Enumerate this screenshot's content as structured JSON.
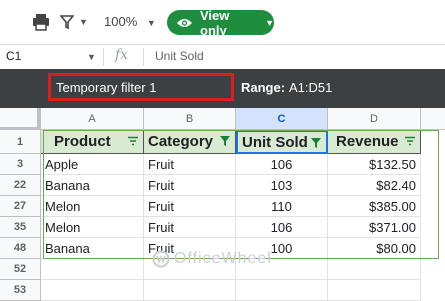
{
  "toolbar": {
    "zoom": "100%",
    "view_button_label": "View only",
    "icons": [
      "print-icon",
      "filter-icon",
      "eye-icon"
    ]
  },
  "formula_bar": {
    "name_box": "C1",
    "fx": "fx",
    "content": "Unit Sold"
  },
  "filter_bar": {
    "filter_name": "Temporary filter 1",
    "range_label": "Range:",
    "range_value": "A1:D51"
  },
  "columns": [
    "A",
    "B",
    "C",
    "D"
  ],
  "headers": [
    "Product",
    "Category",
    "Unit Sold",
    "Revenue"
  ],
  "row_numbers": [
    "1",
    "3",
    "22",
    "27",
    "35",
    "48",
    "52",
    "53"
  ],
  "rows": [
    [
      "Apple",
      "Fruit",
      "106",
      "$132.50"
    ],
    [
      "Banana",
      "Fruit",
      "103",
      "$82.40"
    ],
    [
      "Melon",
      "Fruit",
      "110",
      "$385.00"
    ],
    [
      "Melon",
      "Fruit",
      "106",
      "$371.00"
    ],
    [
      "Banana",
      "Fruit",
      "100",
      "$80.00"
    ]
  ],
  "watermark": "OfficeWheel",
  "colors": {
    "accent_green": "#1e8e3e",
    "header_fill": "#d9ead3",
    "filter_bar": "#3c4043",
    "highlight_red": "#e11a1a",
    "selection_blue": "#1a73e8"
  }
}
